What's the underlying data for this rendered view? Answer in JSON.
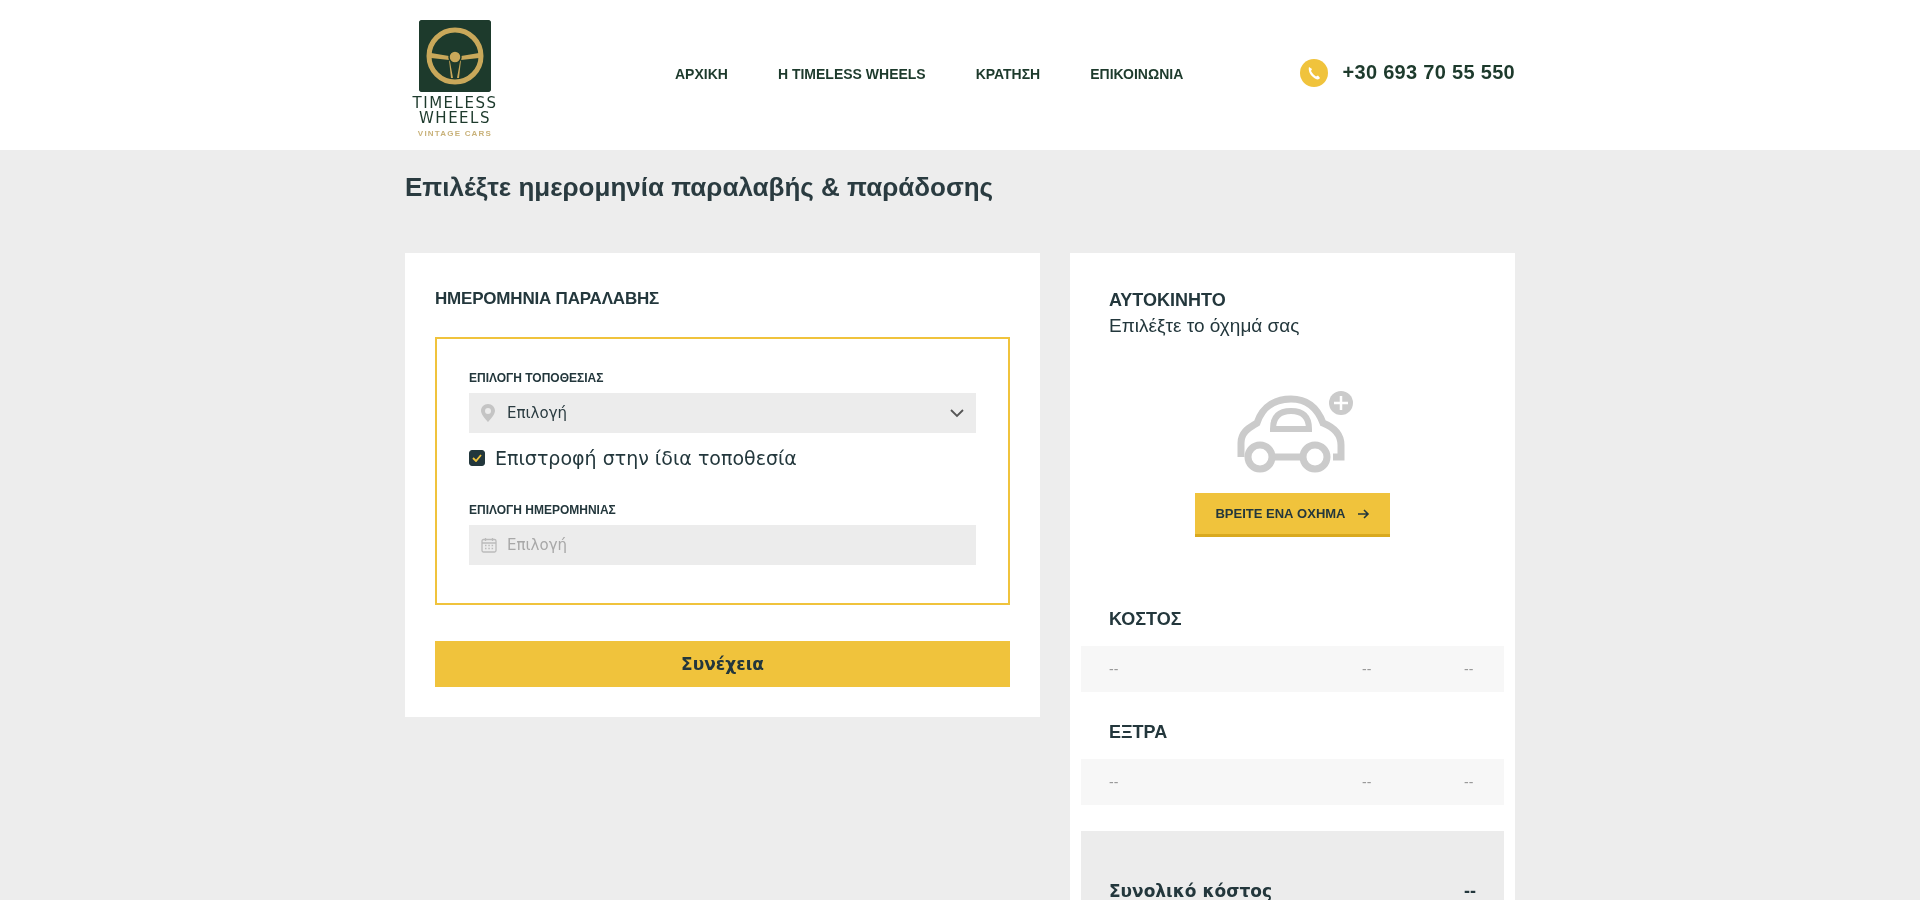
{
  "header": {
    "logo": {
      "line_1": "TIMELESS",
      "line_2": "WHEELS",
      "tagline": "VINTAGE CARS"
    },
    "nav": [
      "ΑΡΧΙΚΗ",
      "Η TIMELESS WHEELS",
      "ΚΡΑΤΗΣΗ",
      "ΕΠΙΚΟΙΝΩΝΙΑ"
    ],
    "phone": "+30 693 70 55 550"
  },
  "page_title": "Επιλέξτε ημερομηνία παραλαβής & παράδοσης",
  "pickup": {
    "heading": "ΗΜΕΡΟΜΗΝΙΑ ΠΑΡΑΛΑΒΗΣ",
    "location": {
      "label": "ΕΠΙΛΟΓΗ ΤΟΠΟΘΕΣΙΑΣ",
      "value": "Επιλογή"
    },
    "same_location": {
      "label": "Επιστροφή στην ίδια τοποθεσία",
      "checked": true
    },
    "date": {
      "label": "ΕΠΙΛΟΓΗ ΗΜΕΡΟΜΗΝΙΑΣ",
      "placeholder": "Επιλογή"
    },
    "continue_button": "Συνέχεια"
  },
  "summary": {
    "car_heading": "ΑΥΤΟΚΙΝΗΤΟ",
    "car_subtitle": "Επιλέξτε το όχημά σας",
    "find_button": "ΒΡΕΙΤΕ ΕΝΑ ΟΧΗΜΑ",
    "sections": [
      {
        "heading": "ΚΟΣΤΟΣ",
        "row": [
          "--",
          "--",
          "--"
        ]
      },
      {
        "heading": "ΕΞΤΡΑ",
        "row": [
          "--",
          "--",
          "--"
        ]
      }
    ],
    "total": {
      "label": "Συνολικό κόστος",
      "value": "--"
    }
  }
}
